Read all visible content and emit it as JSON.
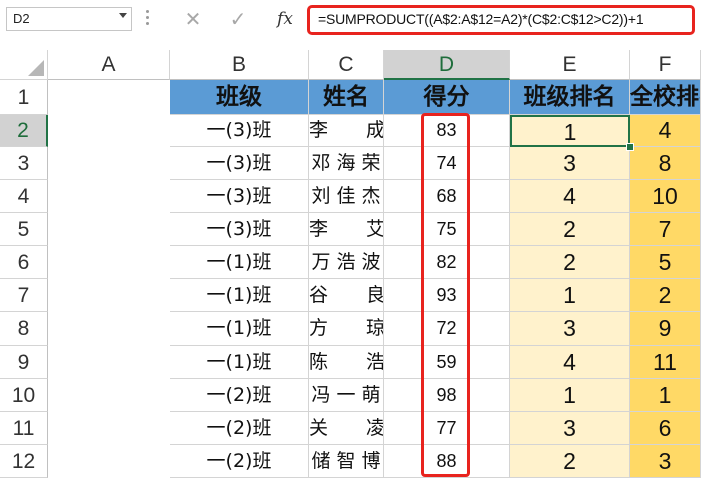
{
  "formula_bar": {
    "name_box": "D2",
    "cancel_icon": "close-icon",
    "enter_icon": "check-icon",
    "fx_label": "fx",
    "formula": "=SUMPRODUCT((A$2:A$12=A2)*(C$2:C$12>C2))+1"
  },
  "columns": [
    "A",
    "B",
    "C",
    "D",
    "E",
    "F"
  ],
  "rows": [
    "1",
    "2",
    "3",
    "4",
    "5",
    "6",
    "7",
    "8",
    "9",
    "10",
    "11",
    "12"
  ],
  "active_cell": "D2",
  "headers": [
    "班级",
    "姓名",
    "得分",
    "班级排名",
    "全校排名"
  ],
  "data": [
    {
      "cls": "一(3)班",
      "name": "李　　成",
      "score": "83",
      "class_rank": "1",
      "school_rank": "4"
    },
    {
      "cls": "一(3)班",
      "name": "邓 海 荣",
      "score": "74",
      "class_rank": "3",
      "school_rank": "8"
    },
    {
      "cls": "一(3)班",
      "name": "刘 佳 杰",
      "score": "68",
      "class_rank": "4",
      "school_rank": "10"
    },
    {
      "cls": "一(3)班",
      "name": "李　　艾",
      "score": "75",
      "class_rank": "2",
      "school_rank": "7"
    },
    {
      "cls": "一(1)班",
      "name": "万 浩 波",
      "score": "82",
      "class_rank": "2",
      "school_rank": "5"
    },
    {
      "cls": "一(1)班",
      "name": "谷　　良",
      "score": "93",
      "class_rank": "1",
      "school_rank": "2"
    },
    {
      "cls": "一(1)班",
      "name": "方　　琼",
      "score": "72",
      "class_rank": "3",
      "school_rank": "9"
    },
    {
      "cls": "一(1)班",
      "name": "陈　　浩",
      "score": "59",
      "class_rank": "4",
      "school_rank": "11"
    },
    {
      "cls": "一(2)班",
      "name": "冯 一 萌",
      "score": "98",
      "class_rank": "1",
      "school_rank": "1"
    },
    {
      "cls": "一(2)班",
      "name": "关　　凌",
      "score": "77",
      "class_rank": "3",
      "school_rank": "6"
    },
    {
      "cls": "一(2)班",
      "name": "储 智 博",
      "score": "88",
      "class_rank": "2",
      "school_rank": "3"
    }
  ],
  "colors": {
    "header_fill": "#5b9bd5",
    "class_rank_fill": "#fff2cc",
    "school_rank_fill": "#ffd966",
    "highlight_border": "#e8231e",
    "selection": "#217346"
  }
}
